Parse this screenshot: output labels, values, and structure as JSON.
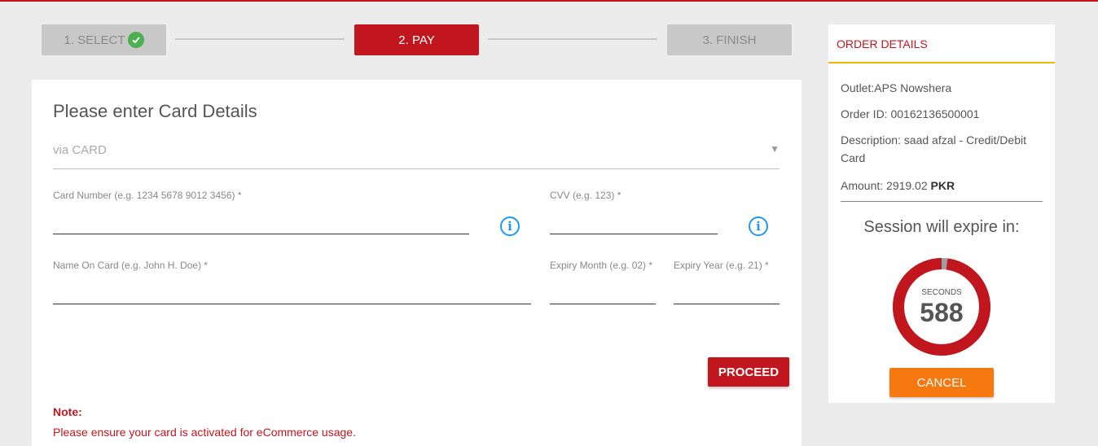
{
  "steps": {
    "step1": "1. SELECT",
    "step2": "2. PAY",
    "step3": "3. FINISH"
  },
  "card": {
    "title": "Please enter Card Details",
    "method": "via CARD",
    "card_number_label": "Card Number (e.g. 1234 5678 9012 3456) *",
    "cvv_label": "CVV (e.g. 123) *",
    "name_label": "Name On Card (e.g. John H. Doe) *",
    "expiry_month_label": "Expiry Month (e.g. 02) *",
    "expiry_year_label": "Expiry Year (e.g. 21) *",
    "proceed": "PROCEED",
    "note_title": "Note:",
    "note_text": "Please ensure your card is activated for eCommerce usage."
  },
  "order": {
    "header": "ORDER DETAILS",
    "outlet": "Outlet:APS Nowshera",
    "order_id": "Order ID: 00162136500001",
    "description": "Description: saad afzal - Credit/Debit Card",
    "amount_prefix": "Amount: 2919.02 ",
    "amount_currency": "PKR",
    "session_text": "Session will expire in:",
    "seconds_label": "SECONDS",
    "seconds_value": "588",
    "seconds_fraction_remaining": 0.98,
    "cancel": "CANCEL"
  },
  "colors": {
    "brand_red": "#c2161f",
    "accent_yellow": "#f5b800",
    "cancel_orange": "#f5790f",
    "info_blue": "#2196f3",
    "success_green": "#4caf50"
  },
  "icons": {
    "check": "check-circle-icon",
    "info": "info-icon",
    "dropdown": "caret-down-icon"
  }
}
